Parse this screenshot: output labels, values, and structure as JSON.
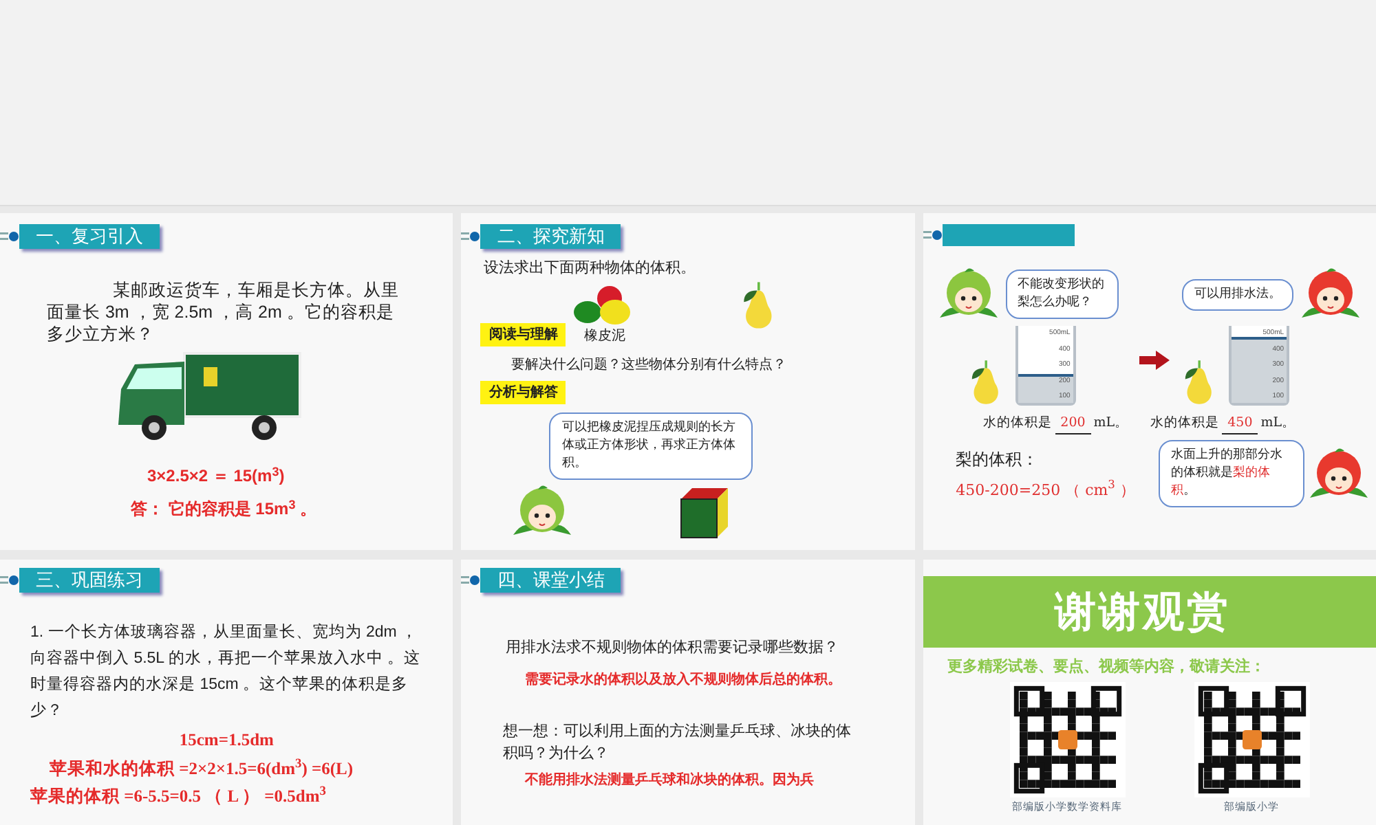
{
  "slides": [
    {
      "kind": "review",
      "heading": "一、复习引入",
      "problem": "某邮政运货车，车厢是长方体。从里面量长 3m ，宽 2.5m ，高 2m 。它的容积是多少立方米？",
      "formula": "3×2.5×2 ＝ 15(m$^{3}$)",
      "answer": "答： 它的容积是 15m$^{3}$ 。"
    },
    {
      "kind": "explore",
      "heading": "二、探究新知",
      "intro": "设法求出下面两种物体的体积。",
      "clay_label": "橡皮泥",
      "tag_read": "阅读与理解",
      "question": "要解决什么问题？这些物体分别有什么特点？",
      "tag_solve": "分析与解答",
      "bubble": "可以把橡皮泥捏压成规则的长方体或正方体形状，再求正方体体积。"
    },
    {
      "kind": "displacement",
      "bubble_left": "不能改变形状的梨怎么办呢？",
      "bubble_right": "可以用排水法。",
      "beakers": [
        {
          "level": 0.38,
          "ticks": [
            "500mL",
            "400",
            "300",
            "200",
            "100"
          ],
          "prefix": "水的体积是",
          "value": "200",
          "suffix": "mL。"
        },
        {
          "level": 0.85,
          "ticks": [
            "500mL",
            "400",
            "300",
            "200",
            "100"
          ],
          "prefix": "水的体积是",
          "value": "450",
          "suffix": "mL。"
        }
      ],
      "pear_label": "梨的体积：",
      "pear_formula": "450-200=250 （ cm$^{3}$ ）",
      "bubble_bottom": "水面上升的那部分水的体积就是",
      "bubble_bottom_highlight": "梨的体积",
      "bubble_bottom_end": "。"
    },
    {
      "kind": "practice",
      "heading": "三、巩固练习",
      "problem": "1. 一个长方体玻璃容器，从里面量长、宽均为 2dm ，向容器中倒入 5.5L 的水，再把一个苹果放入水中 。这时量得容器内的水深是 15cm 。这个苹果的体积是多少？",
      "lines": [
        "15cm=1.5dm",
        "苹果和水的体积 =2×2×1.5=6(dm$^{3}$) =6(L)",
        "苹果的体积 =6-5.5=0.5 （ L ） =0.5dm$^{3}$"
      ]
    },
    {
      "kind": "summary",
      "heading": "四、课堂小结",
      "question": "用排水法求不规则物体的体积需要记录哪些数据？",
      "answer": "需要记录水的体积以及放入不规则物体后总的体积。",
      "think": "想一想：可以利用上面的方法测量乒乓球、冰块的体积吗？为什么？",
      "think_answer": "不能用排水法测量乒乓球和冰块的体积。因为兵"
    },
    {
      "kind": "thanks",
      "banner": "谢谢观赏",
      "subtitle": "更多精彩试卷、要点、视频等内容，敬请关注：",
      "qr_captions": [
        "部编版小学数学资料库",
        "部编版小学"
      ]
    }
  ]
}
